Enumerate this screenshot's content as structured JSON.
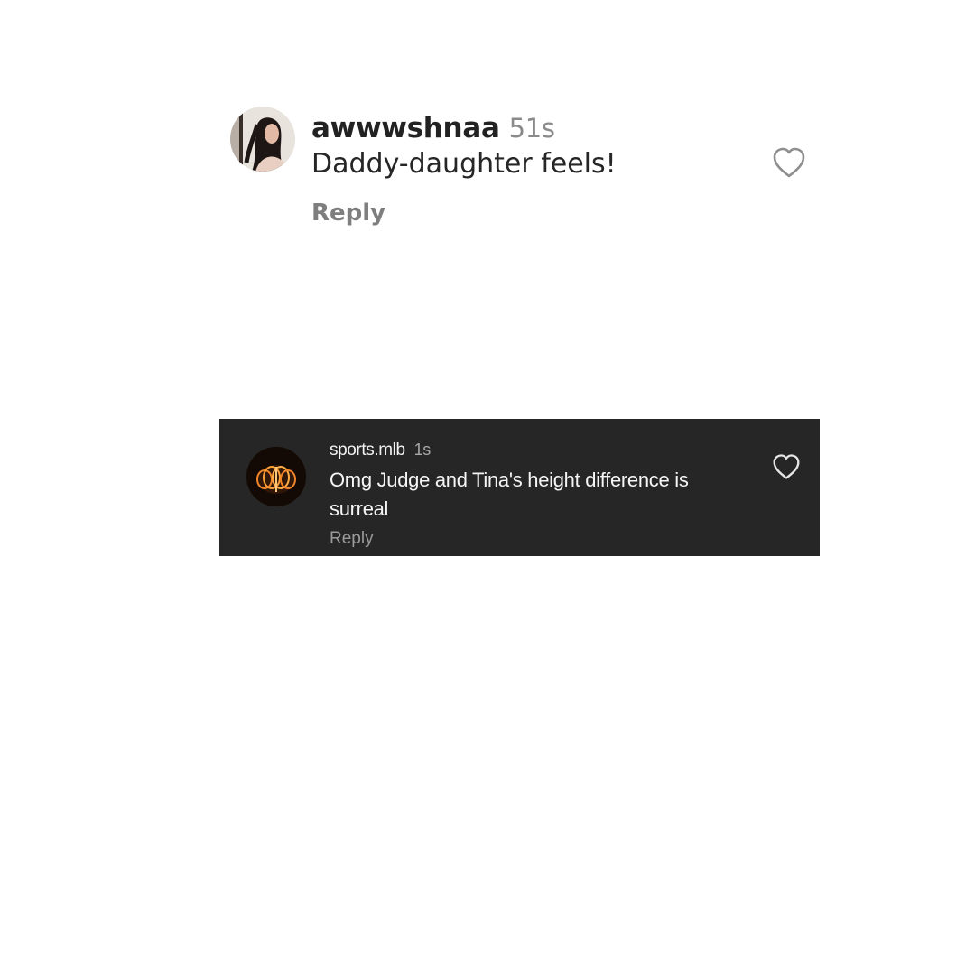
{
  "comments": [
    {
      "username": "awwwshnaa",
      "time": "51s",
      "text": "Daddy-daughter feels!",
      "reply_label": "Reply",
      "like_icon": "heart-outline-icon",
      "theme": "light"
    },
    {
      "username": "sports.mlb",
      "time": "1s",
      "text": "Omg Judge and Tina's height difference is surreal",
      "reply_label": "Reply",
      "like_icon": "heart-outline-icon",
      "theme": "dark"
    }
  ],
  "colors": {
    "light_background": "#ffffff",
    "dark_background": "#262626",
    "muted_text": "#8a8a8a"
  }
}
